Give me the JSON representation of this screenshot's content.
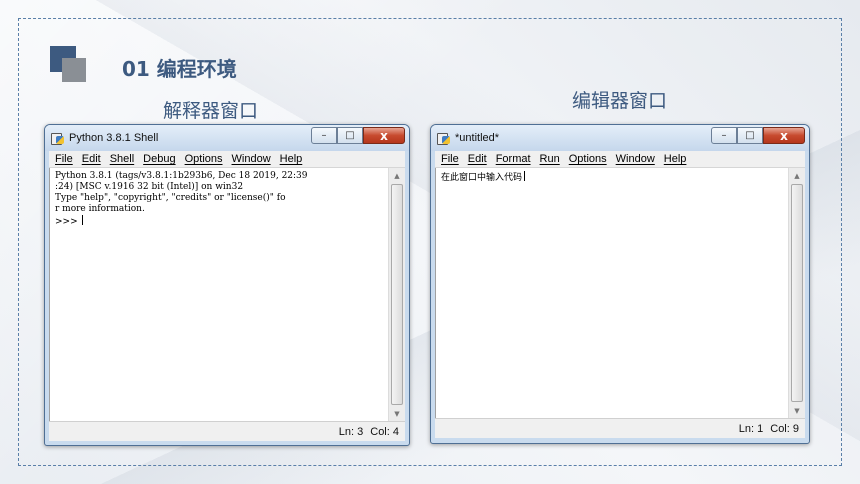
{
  "slide": {
    "section_title": "01 编程环境",
    "caption_interpreter": "解释器窗口",
    "caption_editor": "编辑器窗口"
  },
  "shell_window": {
    "title": "Python 3.8.1 Shell",
    "menu": [
      "File",
      "Edit",
      "Shell",
      "Debug",
      "Options",
      "Window",
      "Help"
    ],
    "lines": [
      "Python 3.8.1 (tags/v3.8.1:1b293b6, Dec 18 2019, 22:39",
      ":24) [MSC v.1916 32 bit (Intel)] on win32",
      "Type \"help\", \"copyright\", \"credits\" or \"license()\" fo",
      "r more information.",
      ">>> "
    ],
    "status_line": "Ln: 3",
    "status_col": "Col: 4"
  },
  "editor_window": {
    "title": "*untitled*",
    "menu": [
      "File",
      "Edit",
      "Format",
      "Run",
      "Options",
      "Window",
      "Help"
    ],
    "content": "在此窗口中输入代码",
    "status_line": "Ln: 1",
    "status_col": "Col: 9"
  },
  "window_controls": {
    "minimize": "–",
    "maximize": "□",
    "close": "x"
  }
}
